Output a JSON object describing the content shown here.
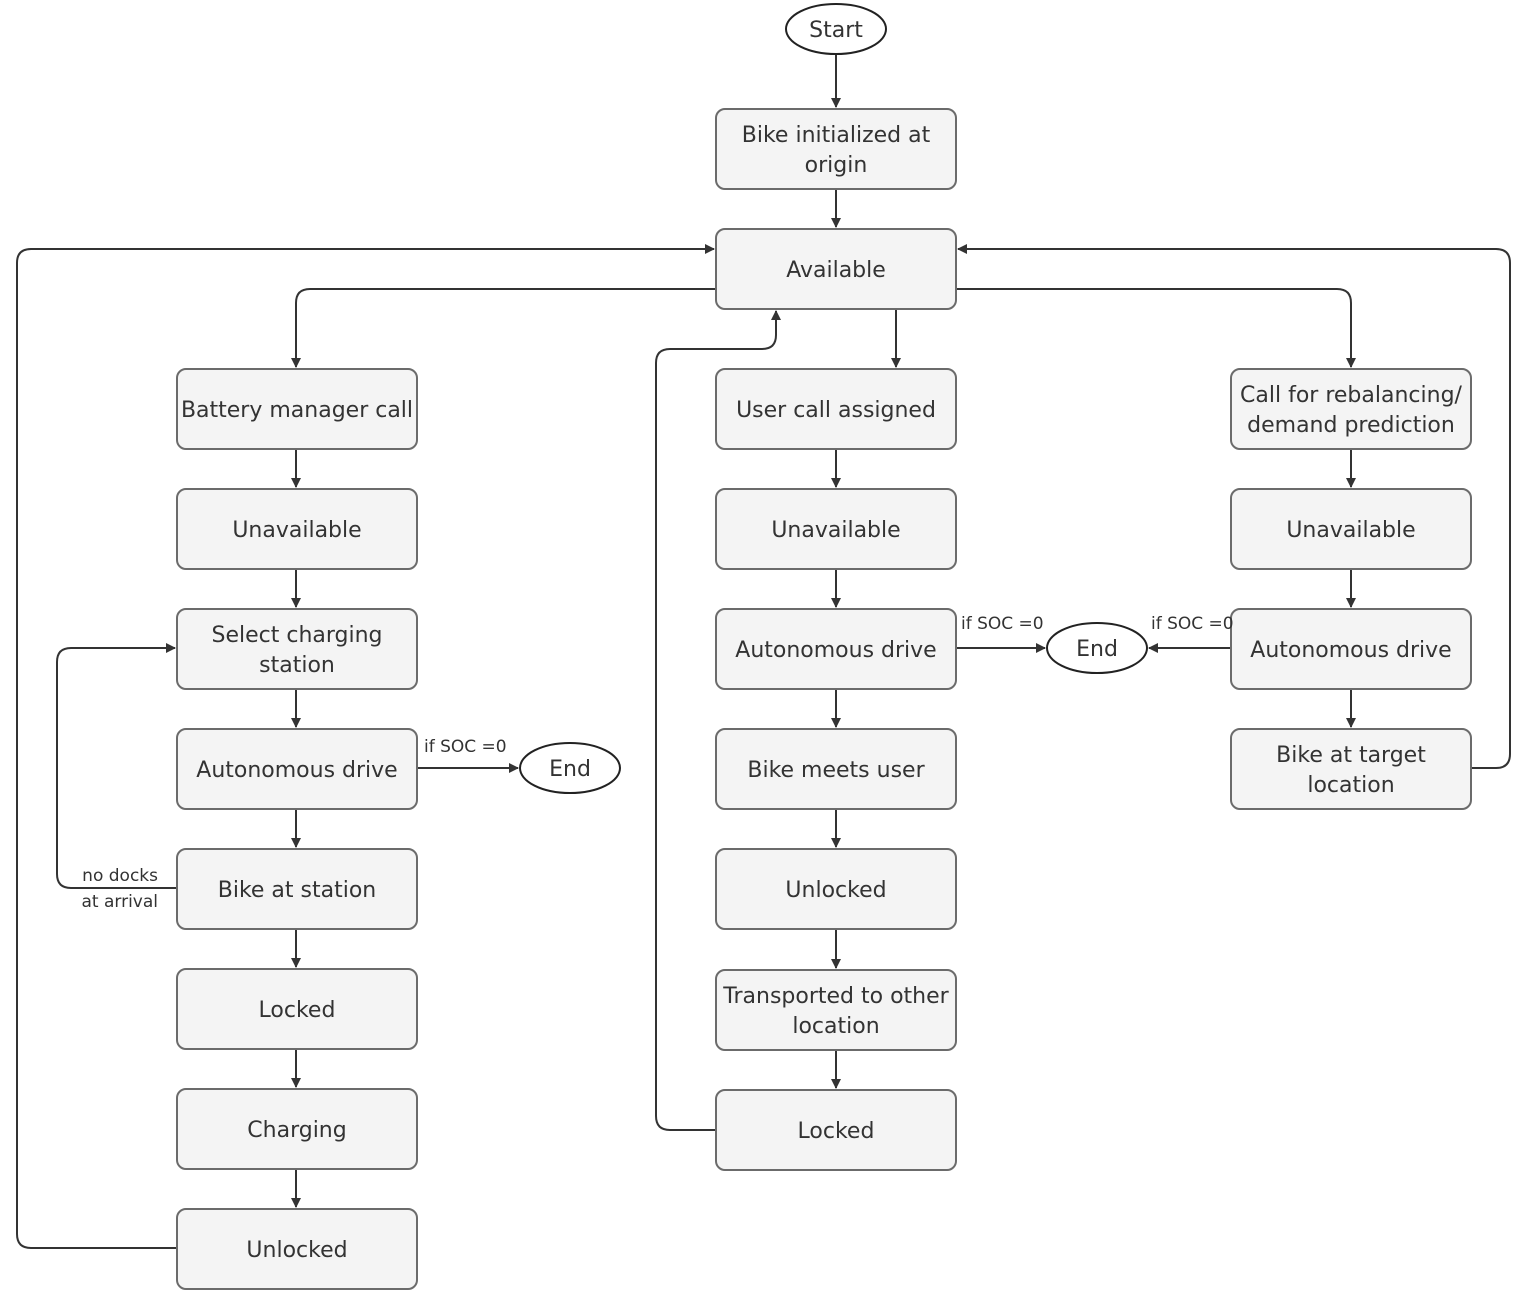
{
  "nodes": [
    {
      "id": "start",
      "shape": "oval",
      "lines": [
        "Start"
      ]
    },
    {
      "id": "init",
      "lines": [
        "Bike initialized at",
        "origin"
      ]
    },
    {
      "id": "available",
      "lines": [
        "Available"
      ]
    },
    {
      "id": "battery",
      "lines": [
        "Battery manager call"
      ]
    },
    {
      "id": "l_unavail",
      "lines": [
        "Unavailable"
      ]
    },
    {
      "id": "select",
      "lines": [
        "Select charging",
        "station"
      ]
    },
    {
      "id": "l_drive",
      "lines": [
        "Autonomous drive"
      ]
    },
    {
      "id": "l_end",
      "shape": "oval",
      "lines": [
        "End"
      ]
    },
    {
      "id": "atstation",
      "lines": [
        "Bike at station"
      ]
    },
    {
      "id": "l_locked",
      "lines": [
        "Locked"
      ]
    },
    {
      "id": "charging",
      "lines": [
        "Charging"
      ]
    },
    {
      "id": "l_unlocked",
      "lines": [
        "Unlocked"
      ]
    },
    {
      "id": "usercall",
      "lines": [
        "User call assigned"
      ]
    },
    {
      "id": "c_unavail",
      "lines": [
        "Unavailable"
      ]
    },
    {
      "id": "c_drive",
      "lines": [
        "Autonomous drive"
      ]
    },
    {
      "id": "c_end",
      "shape": "oval",
      "lines": [
        "End"
      ]
    },
    {
      "id": "meets",
      "lines": [
        "Bike meets user"
      ]
    },
    {
      "id": "c_unlocked",
      "lines": [
        "Unlocked"
      ]
    },
    {
      "id": "transported",
      "lines": [
        "Transported to other",
        "location"
      ]
    },
    {
      "id": "c_locked",
      "lines": [
        "Locked"
      ]
    },
    {
      "id": "rebalance",
      "lines": [
        "Call for rebalancing/",
        "demand prediction"
      ]
    },
    {
      "id": "r_unavail",
      "lines": [
        "Unavailable"
      ]
    },
    {
      "id": "r_drive",
      "lines": [
        "Autonomous drive"
      ]
    },
    {
      "id": "target",
      "lines": [
        "Bike at target",
        "location"
      ]
    }
  ],
  "edge_labels": [
    {
      "id": "soc_left",
      "lines": [
        "if SOC =0"
      ]
    },
    {
      "id": "soc_center",
      "lines": [
        "if SOC =0"
      ]
    },
    {
      "id": "soc_right",
      "lines": [
        "if SOC =0"
      ]
    },
    {
      "id": "nodocks",
      "lines": [
        "no docks",
        "at arrival"
      ]
    }
  ],
  "colors": {
    "box_fill": "#f4f4f4",
    "box_stroke": "#6b6b6b",
    "edge": "#333333"
  }
}
